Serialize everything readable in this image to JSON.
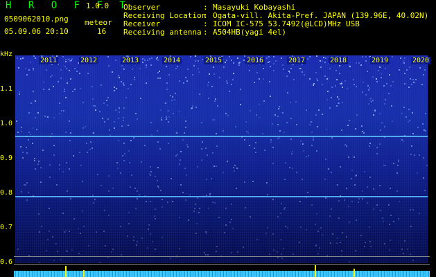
{
  "brand": "H R O F F T",
  "version": "1.0.0",
  "file": "0509062010.png",
  "datetime": "05.09.06 20:10",
  "meteor_label": "meteor",
  "meteor_count": "16",
  "meta": [
    {
      "key": "Observer",
      "value": "Masayuki Kobayashi"
    },
    {
      "key": "Receiving Location",
      "value": "Ogata-vill. Akita-Pref. JAPAN (139.96E, 40.02N)"
    },
    {
      "key": "Receiver",
      "value": "ICOM IC-575 53.7492(@LCD)MHz USB"
    },
    {
      "key": "Receiving antenna",
      "value": "A504HB(yagi 4el)"
    }
  ],
  "y_unit": "kHz",
  "y_ticks": [
    "1.1",
    "1.0",
    "0.9",
    "0.8",
    "0.7",
    "0.6"
  ],
  "x_ticks": [
    "2011",
    "2012",
    "2013",
    "2014",
    "2015",
    "2016",
    "2017",
    "2018",
    "2019",
    "2020"
  ],
  "colors": {
    "text": "#ffff00",
    "brand": "#00ff00",
    "trace": "#57b8ff",
    "background": "#000000"
  }
}
